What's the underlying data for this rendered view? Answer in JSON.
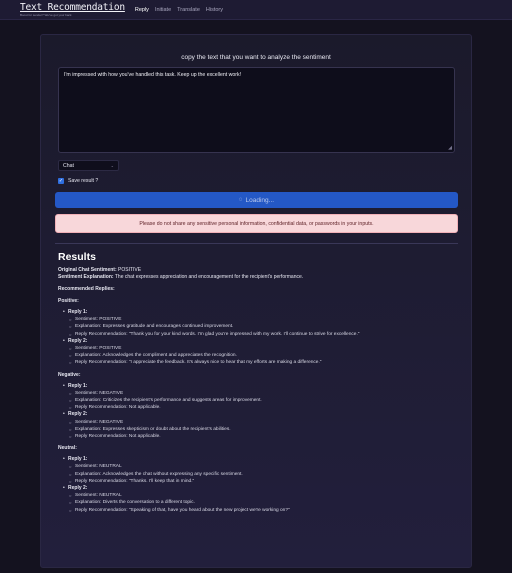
{
  "nav": {
    "brand_title": "Text Recommendation",
    "brand_tag": "Boost for sender? We've got your back",
    "links": [
      "Reply",
      "Initiate",
      "Translate",
      "History"
    ],
    "active": "Reply"
  },
  "form": {
    "prompt": "copy the text that you want to analyze the sentiment",
    "textarea_value": "I'm impressed with how you've handled this task. Keep up the excellent work!",
    "select_value": "Chat",
    "save_label": "Save result ?",
    "save_checked": true,
    "loading_label": "Loading...",
    "warning": "Please do not share any sensitive personal information, confidential data, or passwords in your inputs."
  },
  "results": {
    "title": "Results",
    "original_label": "Original Chat Sentiment:",
    "original_value": "POSITIVE",
    "explanation_label": "Sentiment Explanation:",
    "explanation_value": "The chat expresses appreciation and encouragement for the recipient's performance.",
    "recommended_label": "Recommended Replies:",
    "groups": [
      {
        "label": "Positive:",
        "replies": [
          {
            "title": "Reply 1:",
            "sentiment": "Sentiment: POSITIVE",
            "explanation": "Explanation: Expresses gratitude and encourages continued improvement.",
            "recommendation": "Reply Recommendation: \"Thank you for your kind words. I'm glad you're impressed with my work. I'll continue to strive for excellence.\""
          },
          {
            "title": "Reply 2:",
            "sentiment": "Sentiment: POSITIVE",
            "explanation": "Explanation: Acknowledges the compliment and appreciates the recognition.",
            "recommendation": "Reply Recommendation: \"I appreciate the feedback. It's always nice to hear that my efforts are making a difference.\""
          }
        ]
      },
      {
        "label": "Negative:",
        "replies": [
          {
            "title": "Reply 1:",
            "sentiment": "Sentiment: NEGATIVE",
            "explanation": "Explanation: Criticizes the recipient's performance and suggests areas for improvement.",
            "recommendation": "Reply Recommendation: Not applicable."
          },
          {
            "title": "Reply 2:",
            "sentiment": "Sentiment: NEGATIVE",
            "explanation": "Explanation: Expresses skepticism or doubt about the recipient's abilities.",
            "recommendation": "Reply Recommendation: Not applicable."
          }
        ]
      },
      {
        "label": "Neutral:",
        "replies": [
          {
            "title": "Reply 1:",
            "sentiment": "Sentiment: NEUTRAL",
            "explanation": "Explanation: Acknowledges the chat without expressing any specific sentiment.",
            "recommendation": "Reply Recommendation: \"Thanks. I'll keep that in mind.\""
          },
          {
            "title": "Reply 2:",
            "sentiment": "Sentiment: NEUTRAL",
            "explanation": "Explanation: Diverts the conversation to a different topic.",
            "recommendation": "Reply Recommendation: \"Speaking of that, have you heard about the new project we're working on?\""
          }
        ]
      }
    ]
  },
  "colors": {
    "accent": "#2458c6",
    "warning_bg": "#f8d7da",
    "warning_text": "#5a1c22"
  }
}
